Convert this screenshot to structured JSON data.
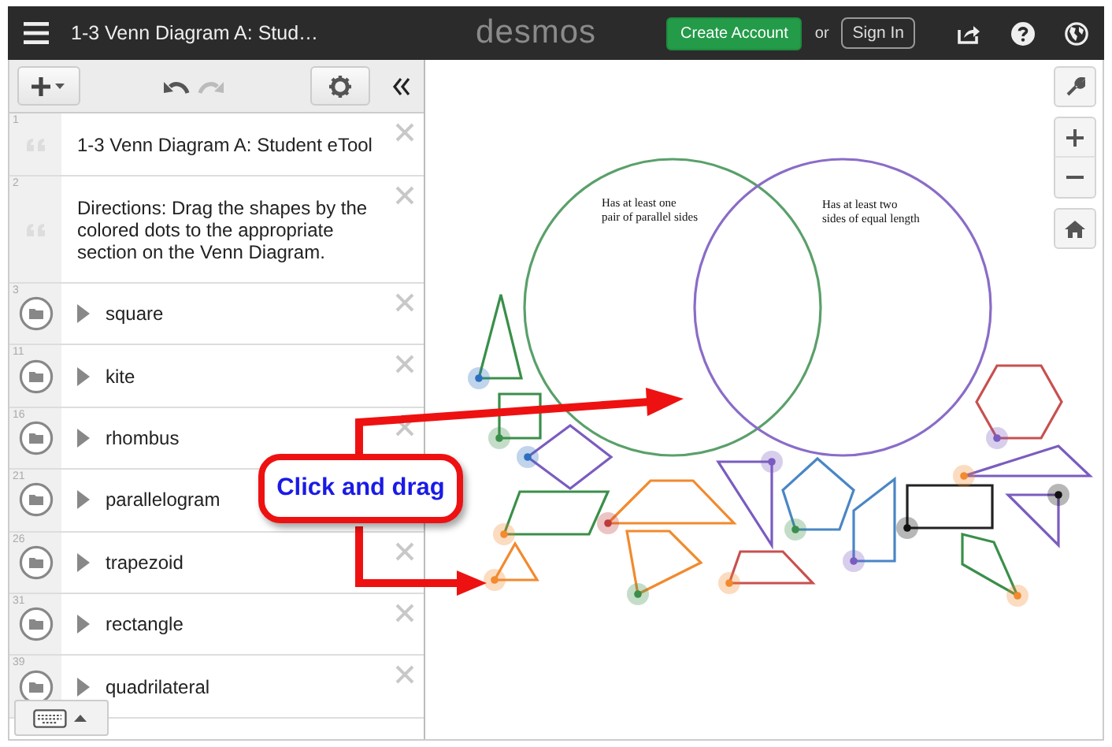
{
  "top_bar": {
    "title": "1-3 Venn Diagram A: Stud…",
    "logo": "desmos",
    "create_account": "Create Account",
    "or": "or",
    "sign_in": "Sign In"
  },
  "expressions": [
    {
      "kind": "note",
      "number": "1",
      "text": "1-3 Venn Diagram A: Student eTool"
    },
    {
      "kind": "note",
      "number": "2",
      "text": "Directions: Drag the shapes by the colored dots to the appropriate section on the Venn Diagram."
    },
    {
      "kind": "folder",
      "number": "3",
      "text": "square",
      "expanded": false
    },
    {
      "kind": "folder",
      "number": "11",
      "text": "kite",
      "expanded": false
    },
    {
      "kind": "folder",
      "number": "16",
      "text": "rhombus",
      "expanded": false
    },
    {
      "kind": "folder",
      "number": "21",
      "text": "parallelogram",
      "expanded": false
    },
    {
      "kind": "folder",
      "number": "26",
      "text": "trapezoid",
      "expanded": false
    },
    {
      "kind": "folder",
      "number": "31",
      "text": "rectangle",
      "expanded": false
    },
    {
      "kind": "folder",
      "number": "39",
      "text": "quadrilateral",
      "expanded": false
    }
  ],
  "venn": {
    "left_label": [
      "Has at least one",
      "pair of parallel sides"
    ],
    "right_label": [
      "Has at least two",
      "sides of equal length"
    ]
  },
  "callout": {
    "text": "Click and drag"
  }
}
